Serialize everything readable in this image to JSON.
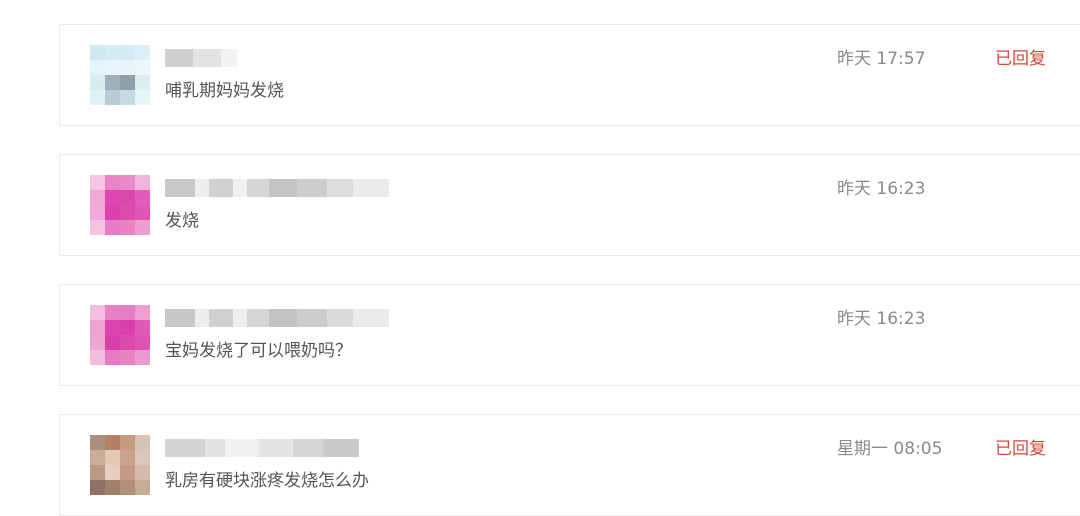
{
  "messages": [
    {
      "avatar_style": "blurred-light-blue",
      "name": "",
      "text": "哺乳期妈妈发烧",
      "time": "昨天 17:57",
      "status": "已回复"
    },
    {
      "avatar_style": "blurred-magenta",
      "name": "",
      "text": "发烧",
      "time": "昨天 16:23",
      "status": ""
    },
    {
      "avatar_style": "blurred-magenta",
      "name": "",
      "text": "宝妈发烧了可以喂奶吗？",
      "time": "昨天 16:23",
      "status": ""
    },
    {
      "avatar_style": "blurred-skin-tone",
      "name": "",
      "text": "乳房有硬块涨疼发烧怎么办",
      "time": "星期一 08:05",
      "status": "已回复"
    }
  ],
  "colors": {
    "status_replied": "#d04a3a",
    "time_text": "#8a8a8a",
    "message_text": "#555555",
    "card_border": "#ececec"
  }
}
